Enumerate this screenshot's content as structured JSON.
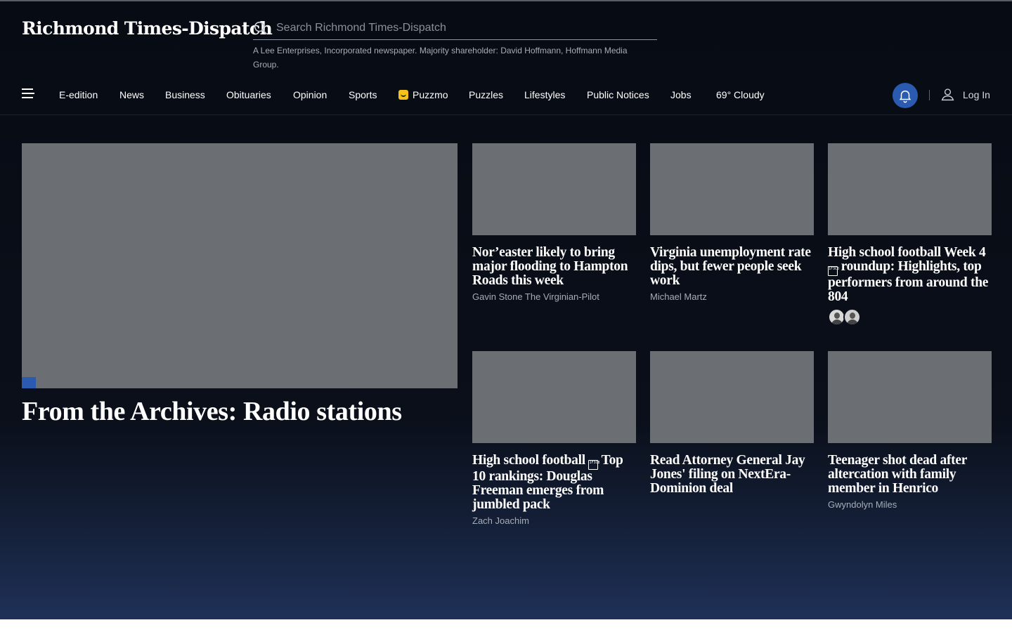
{
  "brand": {
    "logo_text": "Richmond Times-Dispatch",
    "ownership_note": "A Lee Enterprises, Incorporated newspaper. Majority shareholder: David Hoffmann, Hoffmann Media Group."
  },
  "search": {
    "placeholder": "Search Richmond Times-Dispatch",
    "value": ""
  },
  "nav": {
    "menu_icon": "hamburger-menu-icon",
    "items": [
      {
        "label": "E-edition"
      },
      {
        "label": "News"
      },
      {
        "label": "Business"
      },
      {
        "label": "Obituaries"
      },
      {
        "label": "Opinion"
      },
      {
        "label": "Sports"
      },
      {
        "label": "Puzzmo",
        "icon": "puzzmo-icon",
        "icon_color": "#f4c21a"
      },
      {
        "label": "Puzzles"
      },
      {
        "label": "Lifestyles"
      },
      {
        "label": "Public Notices"
      },
      {
        "label": "Jobs"
      }
    ],
    "weather": "69° Cloudy",
    "notifications_icon": "bell-icon",
    "login_label": "Log In",
    "login_icon": "user-icon"
  },
  "hero": {
    "title": "From the Archives: Radio stations",
    "badge_color": "#2a5bb0"
  },
  "cards": [
    {
      "title": "Nor’easter likely to bring major flooding to Hampton Roads this week",
      "byline": "Gavin Stone The Virginian-Pilot"
    },
    {
      "title": "Virginia unemployment rate dips, but fewer people seek work",
      "byline": "Michael Martz"
    },
    {
      "title_before": "High school football Week 4 ",
      "glyph": "1F3C8",
      "title_after": " roundup: Highlights, top performers from around the 804",
      "byline": ""
    },
    {
      "title_before": "High school football ",
      "glyph": "1F3C8",
      "title_after": " Top 10 rankings: Douglas Freeman emerges from jumbled pack",
      "byline": "Zach Joachim"
    },
    {
      "title": "Read Attorney General Jay Jones' filing on NextEra-Dominion deal",
      "byline": ""
    },
    {
      "title": "Teenager shot dead after altercation with family member in Henrico",
      "byline": "Gwyndolyn Miles"
    }
  ],
  "colors": {
    "background_dark": "#0a0f1a",
    "gradient_bottom": "#1f3158",
    "accent_blue": "#2a5bb0",
    "image_placeholder": "#6b6e72",
    "byline_gray": "#a7adb8"
  }
}
